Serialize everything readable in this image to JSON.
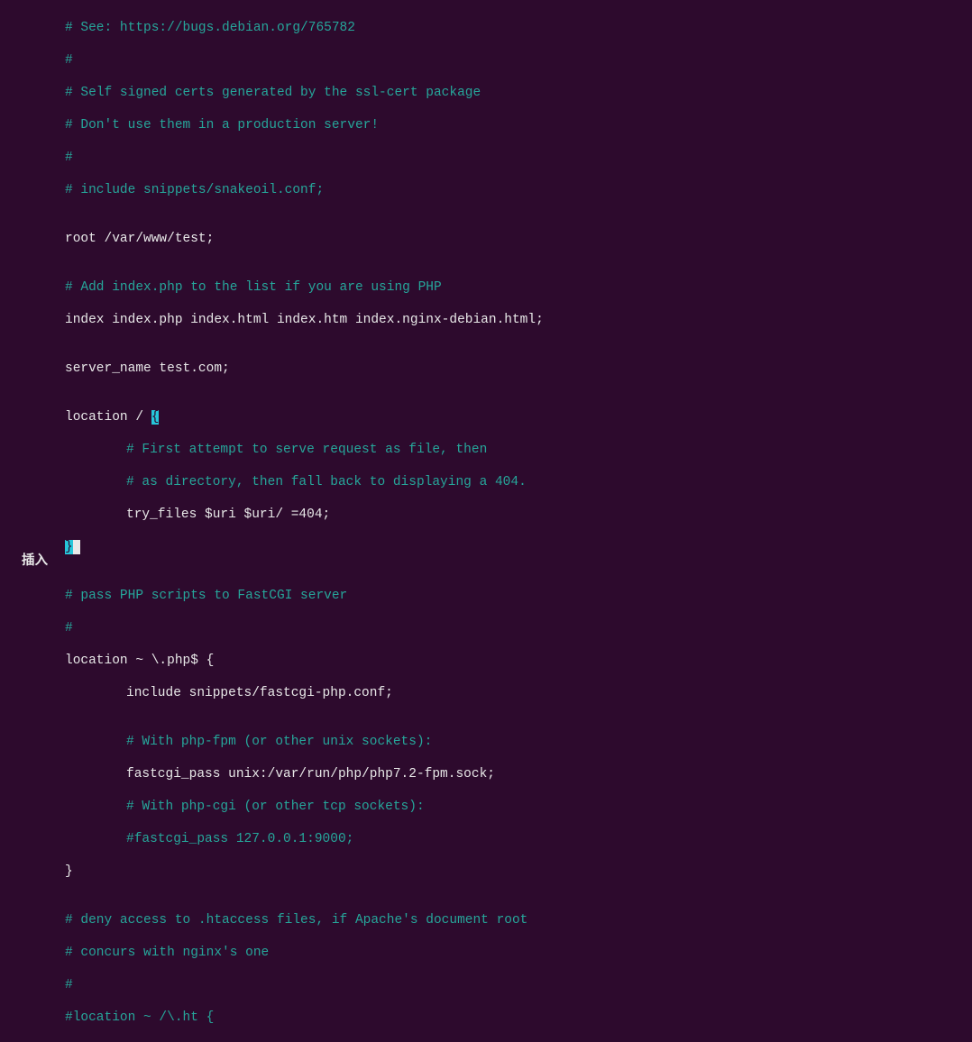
{
  "lines": {
    "l1": "# See: https://bugs.debian.org/765782",
    "l2": "#",
    "l3": "# Self signed certs generated by the ssl-cert package",
    "l4": "# Don't use them in a production server!",
    "l5": "#",
    "l6": "# include snippets/snakeoil.conf;",
    "l7": "",
    "l8": "root /var/www/test;",
    "l9": "",
    "l10": "# Add index.php to the list if you are using PHP",
    "l11": "index index.php index.html index.htm index.nginx-debian.html;",
    "l12": "",
    "l13": "server_name test.com;",
    "l14": "",
    "l15a": "location / ",
    "l15b": "{",
    "l16": "# First attempt to serve request as file, then",
    "l17": "# as directory, then fall back to displaying a 404.",
    "l18": "try_files $uri $uri/ =404;",
    "l19a": "}",
    "l19b": " ",
    "l20": "",
    "l21": "# pass PHP scripts to FastCGI server",
    "l22": "#",
    "l23": "location ~ \\.php$ {",
    "l24": "include snippets/fastcgi-php.conf;",
    "l25": "",
    "l26": "# With php-fpm (or other unix sockets):",
    "l27": "fastcgi_pass unix:/var/run/php/php7.2-fpm.sock;",
    "l28": "# With php-cgi (or other tcp sockets):",
    "l29": "#fastcgi_pass 127.0.0.1:9000;",
    "l30": "}",
    "l31": "",
    "l32": "# deny access to .htaccess files, if Apache's document root",
    "l33": "# concurs with nginx's one",
    "l34": "#",
    "l35": "#location ~ /\\.ht {"
  },
  "mode": "插入"
}
